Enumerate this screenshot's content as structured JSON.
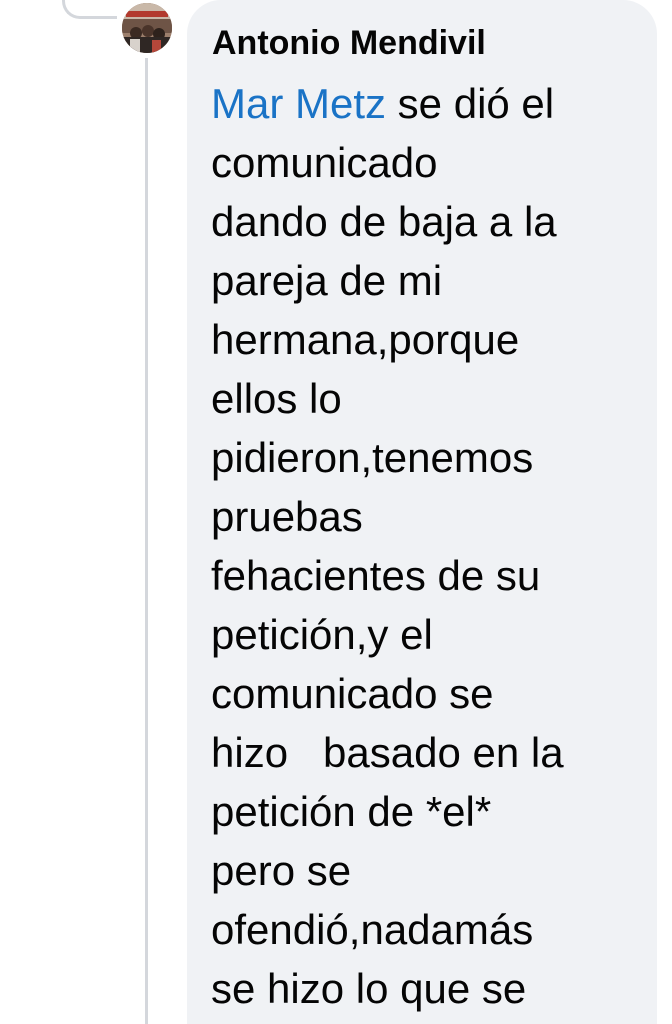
{
  "comment": {
    "author": "Antonio Mendivil",
    "mention": "Mar Metz",
    "text_after_mention": " se dió el",
    "lines": [
      "comunicado",
      "dando de baja a la",
      "pareja de mi",
      "hermana,porque",
      "ellos lo",
      "pidieron,tenemos",
      "pruebas",
      "fehacientes de su",
      "petición,y el",
      "comunicado se",
      "hizo   basado en la",
      "petición de *el*",
      "pero se",
      "ofendió,nadamás",
      "se hizo lo que se"
    ]
  },
  "colors": {
    "bubble_background": "#f0f2f5",
    "mention_link": "#1a73c6",
    "text": "#050505",
    "thread_line": "#d4d7dc"
  },
  "icons": {
    "avatar": "profile-photo"
  }
}
